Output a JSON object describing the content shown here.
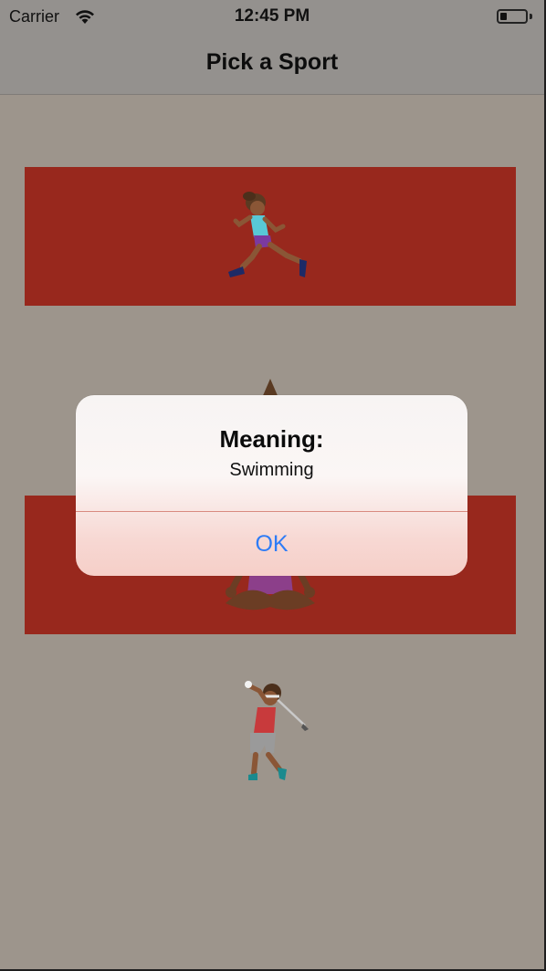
{
  "status_bar": {
    "carrier": "Carrier",
    "time": "12:45 PM",
    "battery_level": 0.25
  },
  "nav": {
    "title": "Pick a Sport"
  },
  "sports": [
    {
      "emoji": "person-running",
      "highlighted": true
    },
    {
      "emoji": "person-in-lotus-position",
      "highlighted": true
    },
    {
      "emoji": "person-golfing",
      "highlighted": false
    }
  ],
  "alert": {
    "title": "Meaning:",
    "message": "Swimming",
    "ok_label": "OK"
  },
  "colors": {
    "background": "#9d958c",
    "band": "#98281d",
    "link_blue": "#2e7cf6"
  }
}
